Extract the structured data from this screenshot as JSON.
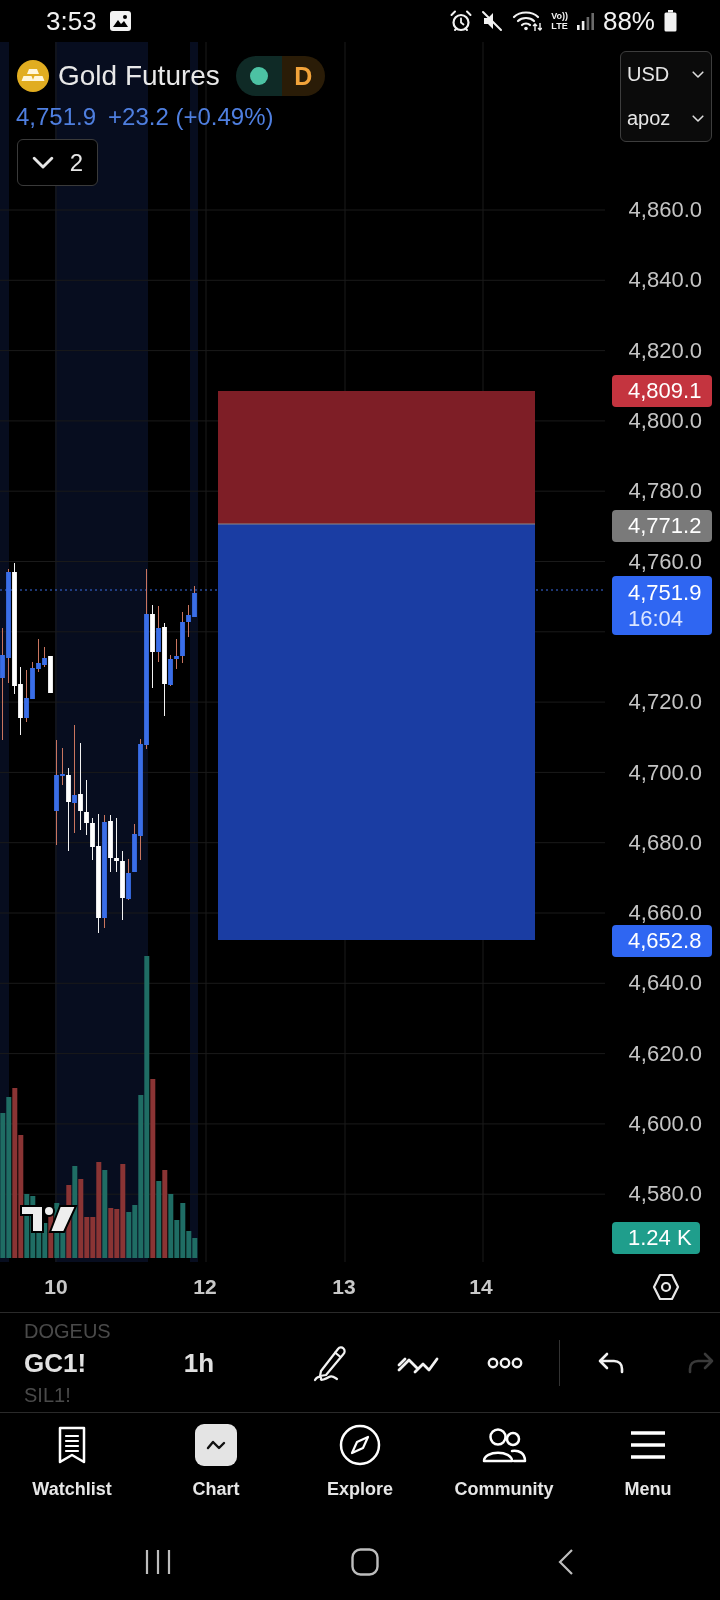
{
  "status_bar": {
    "time": "3:53",
    "network": {
      "top": "Vo))",
      "bottom": "LTE"
    },
    "battery": "88%"
  },
  "header": {
    "symbol": "Gold Futures",
    "status_letter": "D",
    "price": "4,751.9",
    "change": "+23.2 (+0.49%)",
    "indicators": {
      "count": "2",
      "expanded": false
    }
  },
  "scale_menu": {
    "currency": "USD",
    "unit": "apoz"
  },
  "chart": {
    "price_axis": {
      "upper_ticks": [
        "4,860.0",
        "4,840.0",
        "4,820.0",
        "4,800.0",
        "4,780.0",
        "4,760.0"
      ],
      "lower_ticks": [
        "4,720.0",
        "4,700.0",
        "4,680.0",
        "4,660.0",
        "4,640.0",
        "4,620.0",
        "4,600.0",
        "4,580.0"
      ]
    },
    "markers": [
      {
        "kind": "stop",
        "label": "4,809.1",
        "color": "#c4343f"
      },
      {
        "kind": "entry",
        "label": "4,771.2",
        "color": "#7a7a7a"
      },
      {
        "kind": "last",
        "label": "4,751.9",
        "countdown": "16:04",
        "color": "#2f66f2"
      },
      {
        "kind": "target",
        "label": "4,652.8",
        "color": "#2f66f2"
      },
      {
        "kind": "volume",
        "label": "1.24 K",
        "color": "#1f9e8c"
      }
    ],
    "time_axis": [
      "10",
      "12",
      "13",
      "14"
    ]
  },
  "toolbar": {
    "symbols": [
      {
        "label": "DOGEUS",
        "selected": false
      },
      {
        "label": "GC1!",
        "selected": true
      },
      {
        "label": "SIL1!",
        "selected": false
      }
    ],
    "interval": "1h",
    "actions": [
      {
        "kind": "undo",
        "disabled": false
      },
      {
        "kind": "redo",
        "disabled": true
      }
    ]
  },
  "nav": {
    "items": [
      {
        "kind": "watchlist",
        "label": "Watchlist",
        "selected": false
      },
      {
        "kind": "chart",
        "label": "Chart",
        "selected": true
      },
      {
        "kind": "explore",
        "label": "Explore",
        "selected": false
      },
      {
        "kind": "community",
        "label": "Community",
        "selected": false
      },
      {
        "kind": "menu",
        "label": "Menu",
        "selected": false
      }
    ]
  }
}
